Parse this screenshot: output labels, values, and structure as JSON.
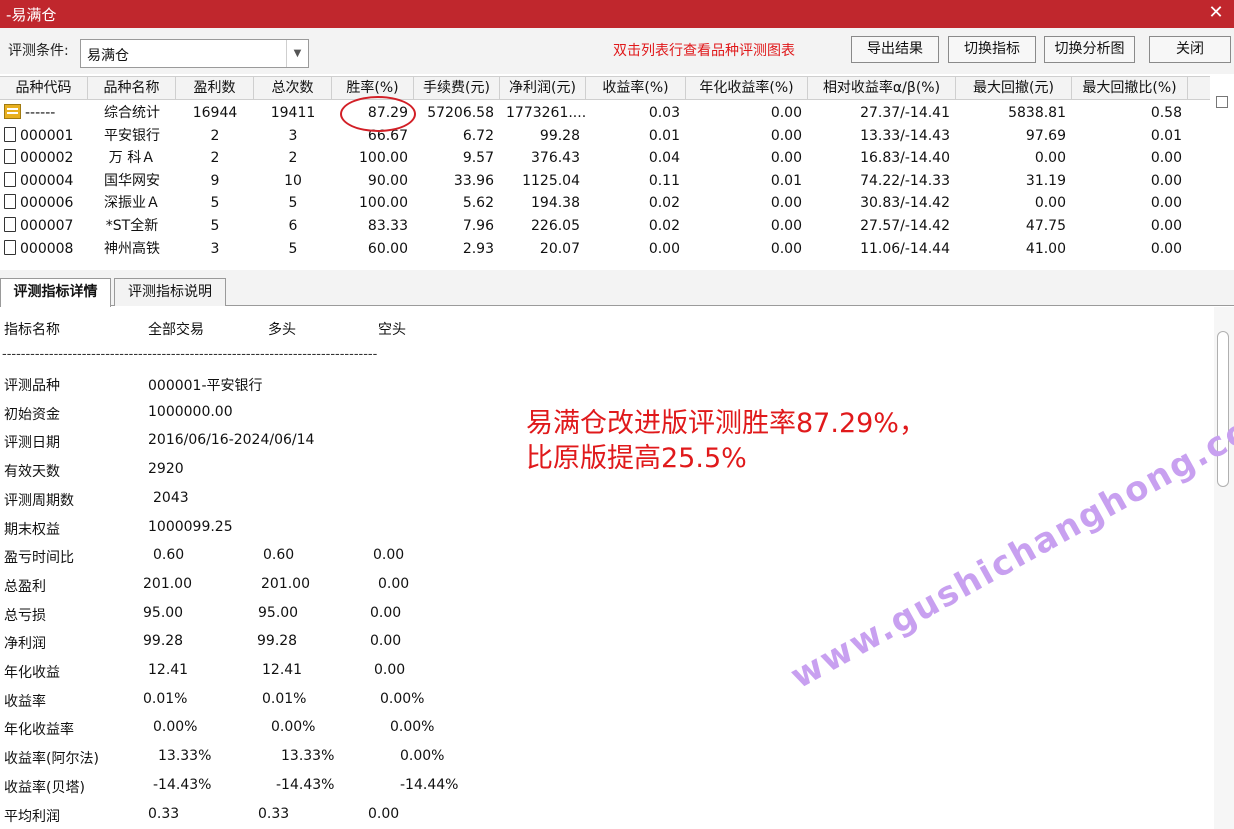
{
  "window": {
    "title": "-易满仓",
    "close_label": "✕"
  },
  "toolbar": {
    "condition_label": "评测条件:",
    "condition_value": "易满仓",
    "hint": "双击列表行查看品种评测图表",
    "buttons": [
      "导出结果",
      "切换指标",
      "切换分析图",
      "关闭"
    ]
  },
  "table": {
    "columns": [
      "品种代码",
      "品种名称",
      "盈利数",
      "总次数",
      "胜率(%)",
      "手续费(元)",
      "净利润(元)",
      "收益率(%)",
      "年化收益率(%)",
      "相对收益率α/β(%)",
      "最大回撤(元)",
      "最大回撤比(%)"
    ],
    "rows": [
      [
        "------",
        "综合统计",
        "16944",
        "19411",
        "87.29",
        "57206.58",
        "1773261....",
        "0.03",
        "0.00",
        "27.37/-14.41",
        "5838.81",
        "0.58"
      ],
      [
        "000001",
        "平安银行",
        "2",
        "3",
        "66.67",
        "6.72",
        "99.28",
        "0.01",
        "0.00",
        "13.33/-14.43",
        "97.69",
        "0.01"
      ],
      [
        "000002",
        "万 科Ａ",
        "2",
        "2",
        "100.00",
        "9.57",
        "376.43",
        "0.04",
        "0.00",
        "16.83/-14.40",
        "0.00",
        "0.00"
      ],
      [
        "000004",
        "国华网安",
        "9",
        "10",
        "90.00",
        "33.96",
        "1125.04",
        "0.11",
        "0.01",
        "74.22/-14.33",
        "31.19",
        "0.00"
      ],
      [
        "000006",
        "深振业Ａ",
        "5",
        "5",
        "100.00",
        "5.62",
        "194.38",
        "0.02",
        "0.00",
        "30.83/-14.42",
        "0.00",
        "0.00"
      ],
      [
        "000007",
        "*ST全新",
        "5",
        "6",
        "83.33",
        "7.96",
        "226.05",
        "0.02",
        "0.00",
        "27.57/-14.42",
        "47.75",
        "0.00"
      ],
      [
        "000008",
        "神州高铁",
        "3",
        "5",
        "60.00",
        "2.93",
        "20.07",
        "0.00",
        "0.00",
        "11.06/-14.44",
        "41.00",
        "0.00"
      ]
    ]
  },
  "tabs": [
    "评测指标详情",
    "评测指标说明"
  ],
  "details": {
    "headers": [
      "指标名称",
      "全部交易",
      "多头",
      "空头"
    ],
    "separator": "--------------------------------------------------------------------------------",
    "rows": [
      [
        "评测品种",
        "000001-平安银行",
        "",
        ""
      ],
      [
        "初始资金",
        "1000000.00",
        "",
        ""
      ],
      [
        "评测日期",
        "2016/06/16-2024/06/14",
        "",
        ""
      ],
      [
        "有效天数",
        "2920",
        "",
        ""
      ],
      [
        "评测周期数",
        "2043",
        "",
        ""
      ],
      [
        "期末权益",
        "1000099.25",
        "",
        ""
      ],
      [
        "盈亏时间比",
        "0.60",
        "0.60",
        "0.00"
      ],
      [
        "总盈利",
        "201.00",
        "201.00",
        "0.00"
      ],
      [
        "总亏损",
        "95.00",
        "95.00",
        "0.00"
      ],
      [
        "净利润",
        "99.28",
        "99.28",
        "0.00"
      ],
      [
        "年化收益",
        "12.41",
        "12.41",
        "0.00"
      ],
      [
        "收益率",
        "0.01%",
        "0.01%",
        "0.00%"
      ],
      [
        "年化收益率",
        "0.00%",
        "0.00%",
        "0.00%"
      ],
      [
        "收益率(阿尔法)",
        "13.33%",
        "13.33%",
        "0.00%"
      ],
      [
        "收益率(贝塔)",
        "-14.43%",
        "-14.43%",
        "-14.44%"
      ],
      [
        "平均利润",
        "0.33",
        "0.33",
        "0.00"
      ]
    ]
  },
  "annotation": {
    "line1": "易满仓改进版评测胜率87.29%，",
    "line2": "比原版提高25.5%"
  },
  "watermark": "www.gushichanghong.com"
}
